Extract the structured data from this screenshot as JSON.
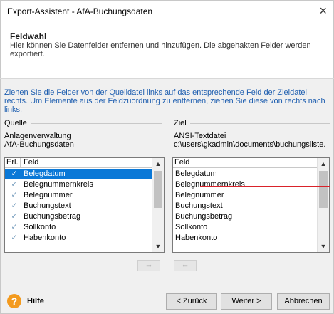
{
  "window": {
    "title": "Export-Assistent - AfA-Buchungsdaten",
    "close_glyph": "×"
  },
  "header": {
    "title": "Feldwahl",
    "description": "Hier können Sie Datenfelder entfernen und hinzufügen. Die abgehakten Felder werden exportiert."
  },
  "instruction": "Ziehen Sie die Felder von der Quelldatei links auf das entsprechende Feld der Zieldatei rechts. Um Elemente aus der Feldzuordnung zu entfernen, ziehen Sie diese von rechts nach links.",
  "source": {
    "group_label": "Quelle",
    "line1": "Anlagenverwaltung",
    "line2": "AfA-Buchungsdaten",
    "col_erl": "Erl.",
    "col_feld": "Feld",
    "items": [
      {
        "checked": true,
        "label": "Belegdatum"
      },
      {
        "checked": true,
        "label": "Belegnummernkreis"
      },
      {
        "checked": true,
        "label": "Belegnummer"
      },
      {
        "checked": true,
        "label": "Buchungstext"
      },
      {
        "checked": true,
        "label": "Buchungsbetrag"
      },
      {
        "checked": true,
        "label": "Sollkonto"
      },
      {
        "checked": true,
        "label": "Habenkonto"
      }
    ],
    "selected_index": 0
  },
  "target": {
    "group_label": "Ziel",
    "line1": "ANSI-Textdatei",
    "line2": "c:\\users\\gkadmin\\documents\\buchungsliste.",
    "col_feld": "Feld",
    "items": [
      "Belegdatum",
      "Belegnummernkreis",
      "Belegnummer",
      "Buchungstext",
      "Buchungsbetrag",
      "Sollkonto",
      "Habenkonto"
    ]
  },
  "mapping_buttons": {
    "add_glyph": "⇒",
    "remove_glyph": "⇐"
  },
  "footer": {
    "help_glyph": "?",
    "help_label": "Hilfe",
    "back_label": "< Zurück",
    "next_label": "Weiter >",
    "cancel_label": "Abbrechen"
  },
  "colors": {
    "accent": "#0a78d7",
    "instruction_text": "#1f5fb0",
    "highlight_line": "#d9222a",
    "help_icon": "#f39a1e"
  },
  "icons": {
    "check": "checkmark-icon",
    "scroll_up": "chevron-up-icon",
    "scroll_down": "chevron-down-icon"
  }
}
